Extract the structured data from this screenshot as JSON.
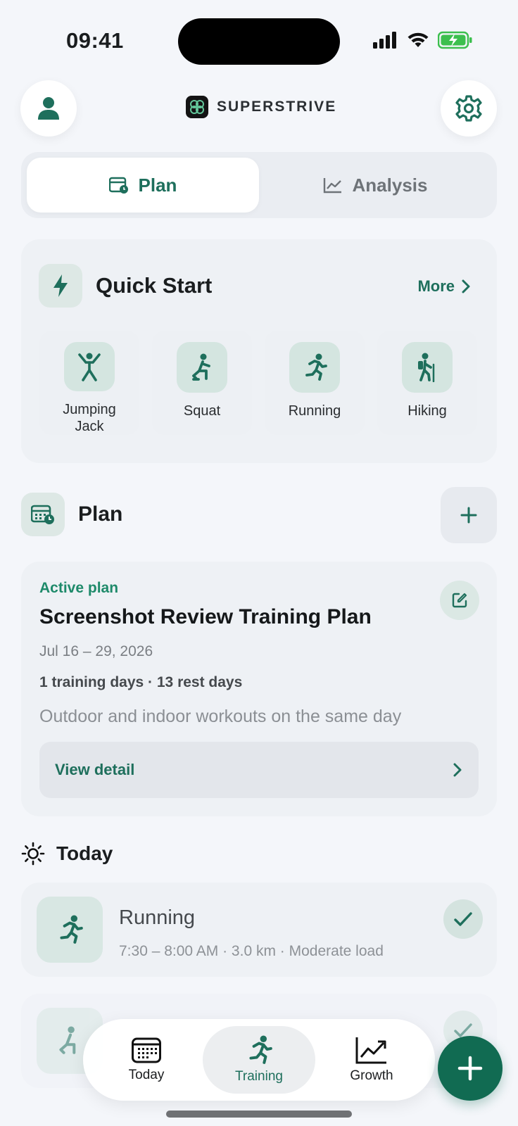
{
  "status_bar": {
    "time": "09:41"
  },
  "header": {
    "brand": "SUPERSTRIVE",
    "profile_icon": "person-icon",
    "settings_icon": "gear-icon"
  },
  "segments": [
    {
      "label": "Plan",
      "icon": "calendar-clock-icon",
      "active": true
    },
    {
      "label": "Analysis",
      "icon": "line-chart-icon",
      "active": false
    }
  ],
  "quick_start": {
    "title": "Quick Start",
    "more_label": "More",
    "items": [
      {
        "label": "Jumping Jack",
        "icon": "jumping-jack-icon"
      },
      {
        "label": "Squat",
        "icon": "squat-icon"
      },
      {
        "label": "Running",
        "icon": "running-icon"
      },
      {
        "label": "Hiking",
        "icon": "hiking-icon"
      }
    ]
  },
  "plan_section": {
    "title": "Plan",
    "card": {
      "status": "Active plan",
      "name": "Screenshot Review Training Plan",
      "dates": "Jul 16 – 29, 2026",
      "stats": "1 training days · 13 rest days",
      "description": "Outdoor and indoor workouts on the same day",
      "view_detail_label": "View detail"
    }
  },
  "today": {
    "title": "Today",
    "workouts": [
      {
        "title": "Running",
        "meta": "7:30 – 8:00 AM · 3.0 km · Moderate load",
        "completed": true
      },
      {
        "title": "",
        "meta": "",
        "completed": true
      }
    ]
  },
  "nav": {
    "tabs": [
      {
        "label": "Today",
        "icon": "calendar-icon",
        "active": false
      },
      {
        "label": "Training",
        "icon": "running-icon",
        "active": true
      },
      {
        "label": "Growth",
        "icon": "trend-up-icon",
        "active": false
      }
    ]
  },
  "colors": {
    "accent": "#1e6f5c",
    "fab": "#116b52",
    "background": "#f4f6fa"
  }
}
